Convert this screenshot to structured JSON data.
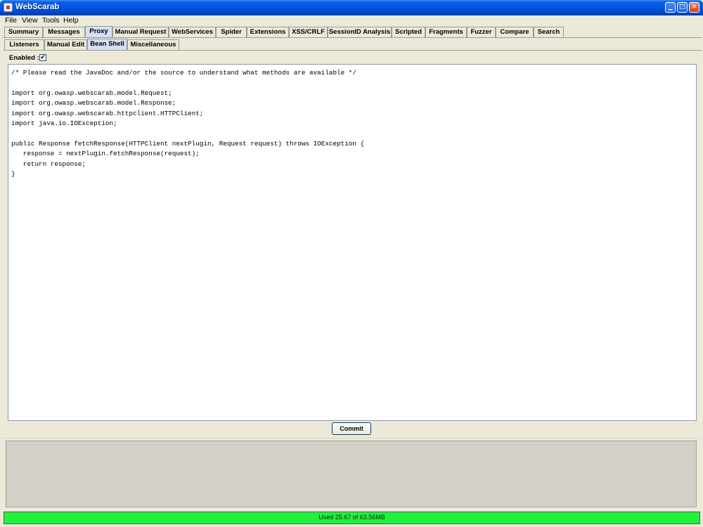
{
  "window": {
    "title": "WebScarab"
  },
  "menu": [
    "File",
    "View",
    "Tools",
    "Help"
  ],
  "main_tabs": [
    {
      "label": "Summary"
    },
    {
      "label": "Messages"
    },
    {
      "label": "Proxy",
      "selected": true
    },
    {
      "label": "Manual Request"
    },
    {
      "label": "WebServices"
    },
    {
      "label": "Spider"
    },
    {
      "label": "Extensions"
    },
    {
      "label": "XSS/CRLF"
    },
    {
      "label": "SessionID Analysis"
    },
    {
      "label": "Scripted"
    },
    {
      "label": "Fragments"
    },
    {
      "label": "Fuzzer"
    },
    {
      "label": "Compare"
    },
    {
      "label": "Search"
    }
  ],
  "sub_tabs": [
    {
      "label": "Listeners"
    },
    {
      "label": "Manual Edit"
    },
    {
      "label": "Bean Shell",
      "selected": true
    },
    {
      "label": "Miscellaneous"
    }
  ],
  "beanshell": {
    "enabled_label": "Enabled :",
    "enabled_checked": true,
    "code": "/* Please read the JavaDoc and/or the source to understand what methods are available */\n\nimport org.owasp.webscarab.model.Request;\nimport org.owasp.webscarab.model.Response;\nimport org.owasp.webscarab.httpclient.HTTPClient;\nimport java.io.IOException;\n\npublic Response fetchResponse(HTTPClient nextPlugin, Request request) throws IOException {\n   response = nextPlugin.fetchResponse(request);\n   return response;\n}",
    "commit_label": "Commit"
  },
  "status": {
    "memory_text": "Used 25.67 of 63.56MB"
  },
  "colors": {
    "status_bar": "#1ef23a",
    "title_bar": "#0054e3",
    "selected_tab": "#d4e0f4"
  },
  "icons": {
    "minimize": "minimize-icon",
    "maximize": "maximize-icon",
    "close": "close-icon",
    "check": "checkmark-icon"
  }
}
